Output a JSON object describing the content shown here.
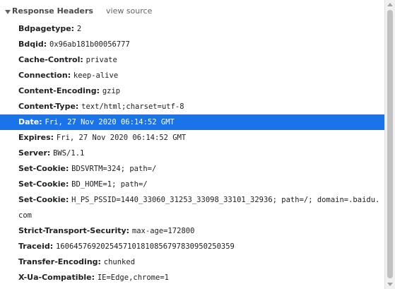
{
  "section": {
    "title": "Response Headers",
    "view_source_label": "view source",
    "expanded_icon": "triangle-down-icon"
  },
  "headers": [
    {
      "name": "Bdpagetype:",
      "value": "2"
    },
    {
      "name": "Bdqid:",
      "value": "0x96ab181b00056777"
    },
    {
      "name": "Cache-Control:",
      "value": "private"
    },
    {
      "name": "Connection:",
      "value": "keep-alive"
    },
    {
      "name": "Content-Encoding:",
      "value": "gzip"
    },
    {
      "name": "Content-Type:",
      "value": "text/html;charset=utf-8"
    },
    {
      "name": "Date:",
      "value": "Fri, 27 Nov 2020 06:14:52 GMT"
    },
    {
      "name": "Expires:",
      "value": "Fri, 27 Nov 2020 06:14:52 GMT"
    },
    {
      "name": "Server:",
      "value": "BWS/1.1"
    },
    {
      "name": "Set-Cookie:",
      "value": "BDSVRTM=324; path=/"
    },
    {
      "name": "Set-Cookie:",
      "value": "BD_HOME=1; path=/"
    },
    {
      "name": "Set-Cookie:",
      "value": "H_PS_PSSID=1440_33060_31253_33098_33101_32936; path=/; domain=.baidu.com"
    },
    {
      "name": "Strict-Transport-Security:",
      "value": "max-age=172800"
    },
    {
      "name": "Traceid:",
      "value": "1606457692025457101810856797830950250359"
    },
    {
      "name": "Transfer-Encoding:",
      "value": "chunked"
    },
    {
      "name": "X-Ua-Compatible:",
      "value": "IE=Edge,chrome=1"
    }
  ],
  "selected_header": "Date:",
  "colors": {
    "selection": "#1a73e8",
    "text": "#202124",
    "muted": "#5f6368"
  }
}
